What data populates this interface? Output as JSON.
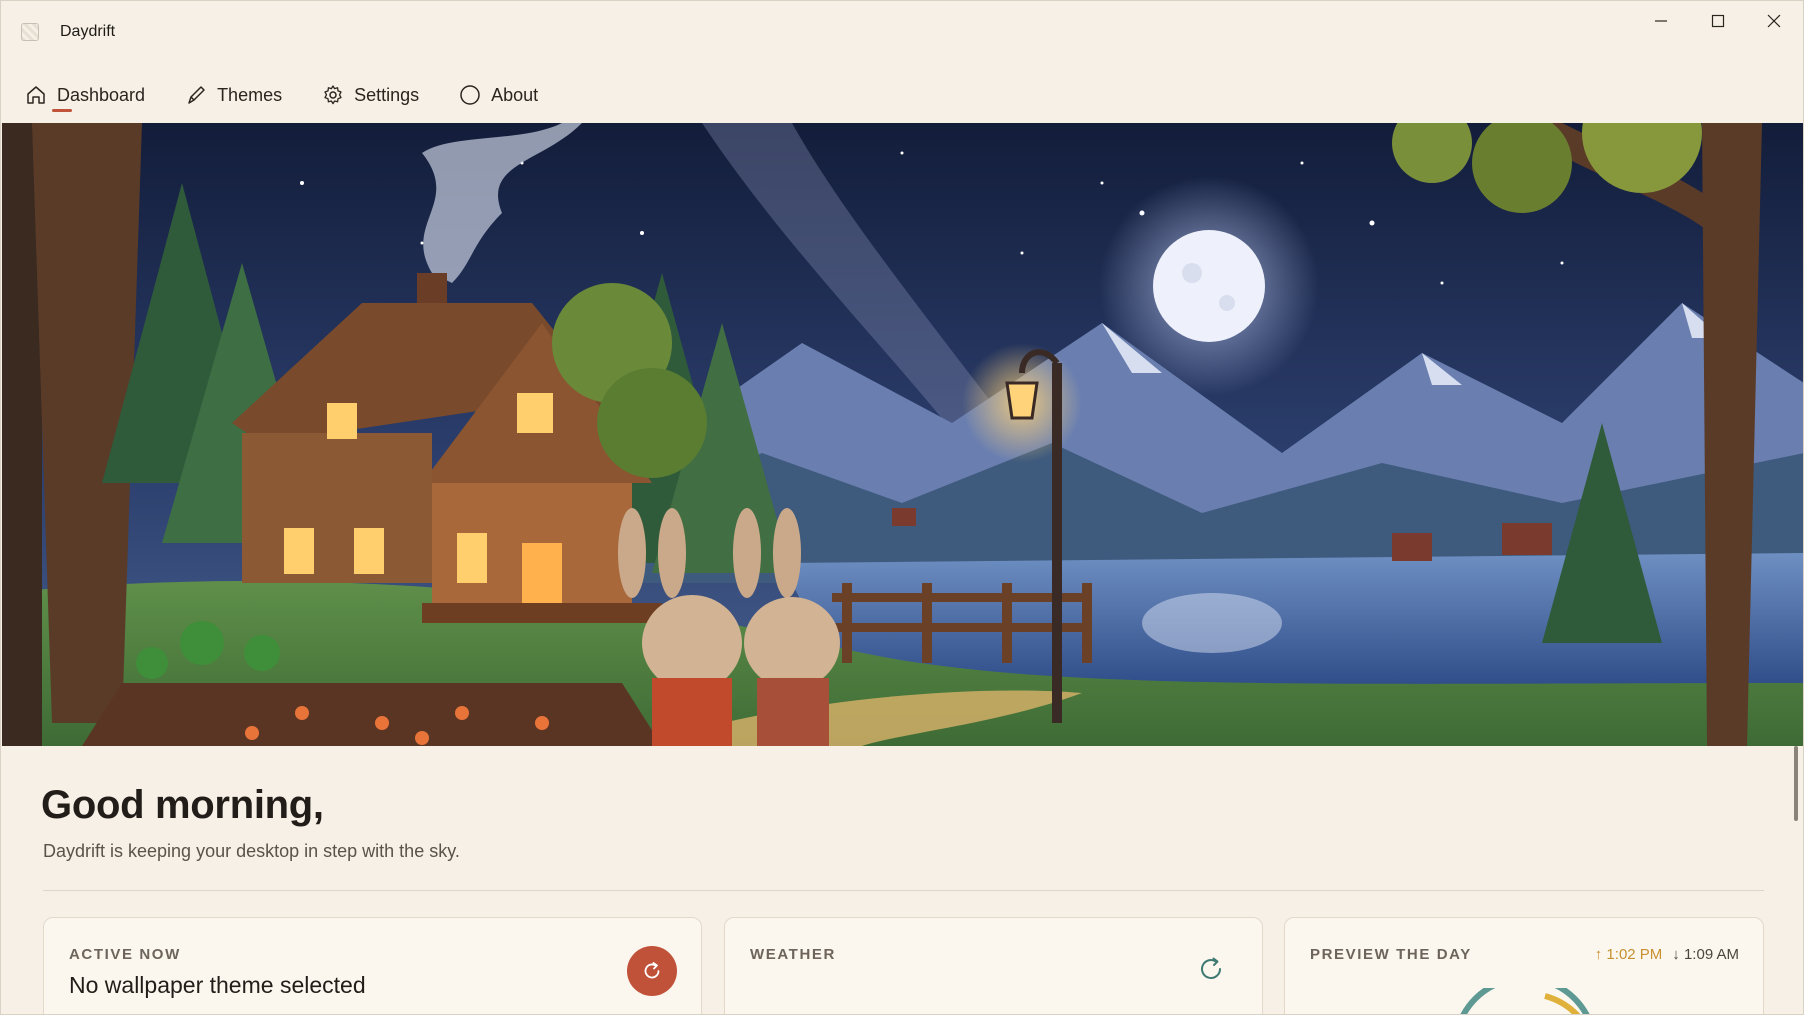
{
  "app": {
    "title": "Daydrift"
  },
  "nav": {
    "items": [
      {
        "label": "Dashboard",
        "icon": "home-icon",
        "active": true
      },
      {
        "label": "Themes",
        "icon": "brush-icon",
        "active": false
      },
      {
        "label": "Settings",
        "icon": "gear-icon",
        "active": false
      },
      {
        "label": "About",
        "icon": "circle-icon",
        "active": false
      }
    ]
  },
  "hero": {
    "scene": "night-cabin-lake-illustration"
  },
  "greeting": {
    "title": "Good morning,",
    "subtitle": "Daydrift is keeping your desktop in step with the sky."
  },
  "cards": {
    "active_now": {
      "label": "ACTIVE NOW",
      "value": "No wallpaper theme selected"
    },
    "weather": {
      "label": "WEATHER"
    },
    "preview": {
      "label": "PREVIEW THE DAY",
      "sunrise": "↑ 1:02 PM",
      "sunset": "↓ 1:09 AM"
    }
  },
  "colors": {
    "accent": "#c1523a",
    "background": "#f6f0e6",
    "card": "#fbf7ef",
    "sunrise": "#c8902e"
  }
}
